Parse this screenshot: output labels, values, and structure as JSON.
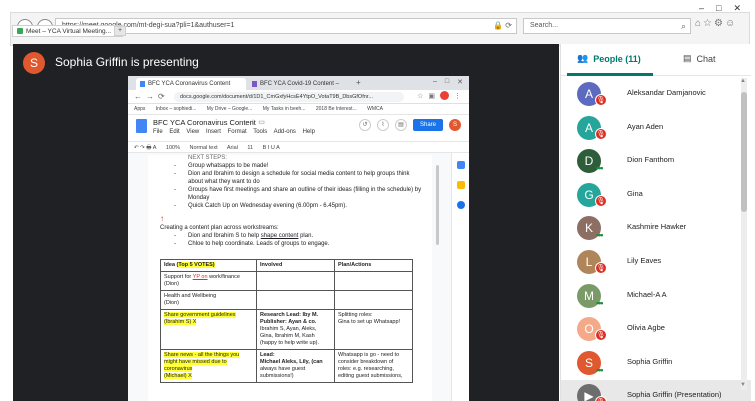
{
  "browser": {
    "address": "https://meet.google.com/mt-degi-sua?pli=1&authuser=1",
    "search_placeholder": "Search...",
    "tab_label": "Meet – YCA Virtual Meeting..."
  },
  "meet": {
    "presenter_initial": "S",
    "presenter_text": "Sophia Griffin is presenting",
    "people_tab": "People (11)",
    "chat_tab": "Chat",
    "participants": [
      {
        "initial": "A",
        "color": "#5c6bc0",
        "name": "Aleksandar Damjanovic",
        "status": "muted"
      },
      {
        "initial": "A",
        "color": "#26a69a",
        "name": "Ayan Aden",
        "status": "muted"
      },
      {
        "initial": "D",
        "color": "#2e5d3a",
        "name": "Dion Fanthom",
        "status": "active"
      },
      {
        "initial": "G",
        "color": "#26a69a",
        "name": "Gina",
        "status": "muted"
      },
      {
        "initial": "K",
        "color": "#8d6e63",
        "name": "Kashmire Hawker",
        "status": "active"
      },
      {
        "initial": "L",
        "color": "#b0855a",
        "name": "Lily Eaves",
        "status": "muted"
      },
      {
        "initial": "M",
        "color": "#7a9a68",
        "name": "Michael-A A",
        "status": "active"
      },
      {
        "initial": "O",
        "color": "#f4a989",
        "name": "Olivia Agbe",
        "status": "muted"
      },
      {
        "initial": "S",
        "color": "#e0582f",
        "name": "Sophia Griffin",
        "status": "active"
      },
      {
        "initial": "▶",
        "color": "#6d6d6d",
        "name": "Sophia Griffin (Presentation)",
        "status": "muted"
      }
    ]
  },
  "shared_doc": {
    "tab1": "BFC YCA Coronavirus Content",
    "tab2": "BFC YCA Covid-19 Content –",
    "url": "docs.google.com/document/d/1D1_CmGxfyHcsE4YtpO_VotaT9B_DbsGfOfnr...",
    "bookmarks": [
      "Apps",
      "Inbox – sophiedi...",
      "My Drive – Google...",
      "My Tasks in beeh...",
      "2018 Be Interest...",
      "WMCA"
    ],
    "title": "BFC YCA Coronavirus Content",
    "menu": [
      "File",
      "Edit",
      "View",
      "Insert",
      "Format",
      "Tools",
      "Add-ons",
      "Help"
    ],
    "share_label": "Share",
    "user_initial": "S",
    "toolbar": [
      "100%",
      "Normal text",
      "Arial",
      "11"
    ],
    "lines": [
      "NEXT STEPS:",
      "Group whatsapps to be made!",
      "Dion and Ibrahim to design a schedule for social media content to help groups think",
      "about what they want to do",
      "Groups have first meetings and share an outline of their ideas (filling in the schedule) by",
      "Monday",
      "Quick Catch Up on Wednesday evening (6.00pm - 6.45pm).",
      "Creating a content plan across workstreams:",
      "Dion and Ibrahim S to help",
      "shape content",
      "plan.",
      "Chloe to help coordinate. Leads of groups to engage."
    ],
    "table": {
      "headers": [
        "Idea",
        "(Top 5 VOTES)",
        "Involved",
        "Plan/Actions"
      ],
      "rows": [
        {
          "idea_a": "Support for",
          "idea_b": "YP on",
          "idea_c": "work/finance",
          "idea_d": "(Dion)",
          "involved": "",
          "plan": ""
        },
        {
          "idea_a": "Health and Wellbeing",
          "idea_d": "(Dion)",
          "involved": "",
          "plan": ""
        },
        {
          "idea_a": "Share government guidelines",
          "idea_d": "(Ibrahim S) X",
          "inv_1": "Research Lead: Iby M.",
          "inv_2": "Publisher: Ayan & co.",
          "inv_3": "Ibrahim S, Ayan, Aleks,",
          "inv_4": "Gina, Ibrahim M, Kash",
          "inv_5": "(happy to help write up).",
          "plan_1": "Splitting roles:",
          "plan_2": "Gina to set up Whatsapp!"
        },
        {
          "idea_a": "Share news - all the things you",
          "idea_b2": "might have missed due to",
          "idea_c2": "coronavirus",
          "idea_d": "(Michael) X",
          "inv_1": "Lead:",
          "inv_2": "Michael Aleks, Lily, (can",
          "inv_3": "always have guest",
          "inv_4": "submissions!)",
          "plan_1": "Whatsapp is go - need to",
          "plan_2": "consider breakdown of",
          "plan_3": "roles: e.g. researching,",
          "plan_4": "editing guest submissions,"
        }
      ]
    }
  },
  "colors": {
    "stage_bg": "#202124",
    "accent_teal": "#00796b",
    "share_button": "#1a73e8",
    "highlight": "#ffff33",
    "mute_badge": "#d93025"
  }
}
